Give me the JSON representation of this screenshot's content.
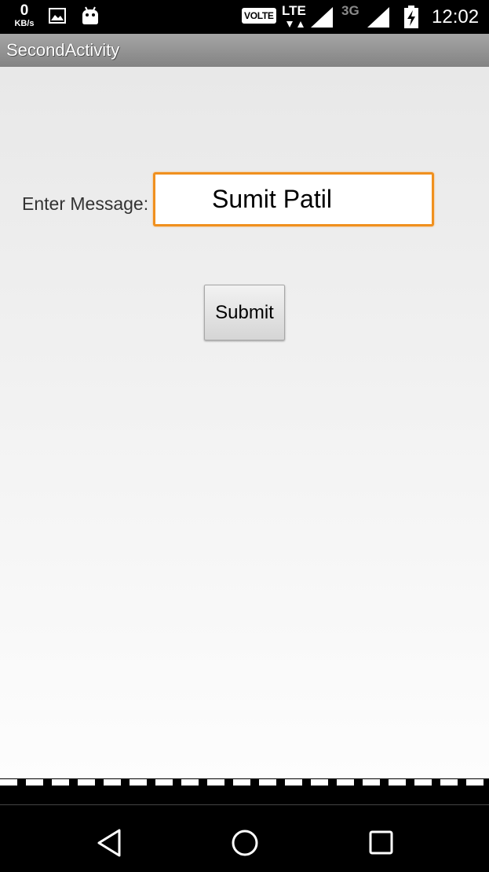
{
  "status_bar": {
    "net_speed_value": "0",
    "net_speed_unit": "KB/s",
    "volte_label": "VOLTE",
    "lte_label": "LTE",
    "secondary_network_label": "3G",
    "time": "12:02",
    "icons": [
      "image-icon",
      "android-icon",
      "signal-icon",
      "signal-icon",
      "battery-charging-icon"
    ]
  },
  "action_bar": {
    "title": "SecondActivity"
  },
  "form": {
    "label": "Enter Message:",
    "input_value": "Sumit Patil",
    "submit_label": "Submit",
    "input_border_color": "#f0901e"
  },
  "nav_bar": {
    "icons": [
      "back-icon",
      "home-icon",
      "recents-icon"
    ]
  }
}
